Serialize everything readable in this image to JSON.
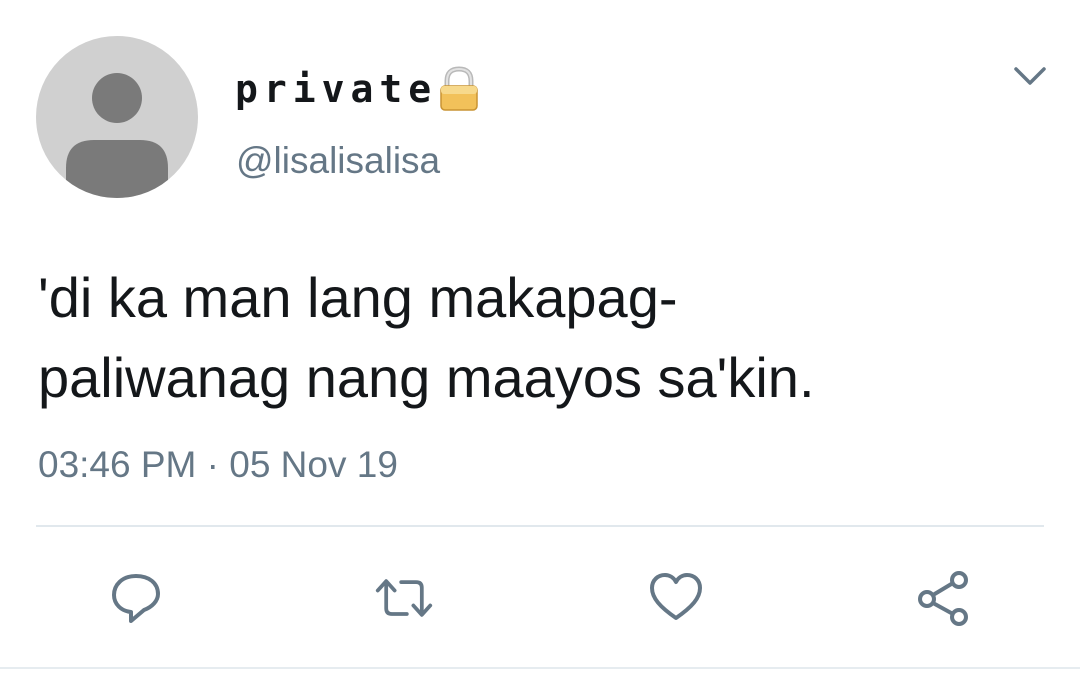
{
  "tweet": {
    "display_name": "private",
    "handle": "@lisalisalisa",
    "text": "'di ka man lang makapag-\npaliwanag nang maayos sa'kin.",
    "timestamp": "03:46 PM · 05 Nov 19"
  },
  "icons": {
    "lock": "lock-icon",
    "caret": "chevron-down-icon",
    "reply": "reply-icon",
    "retweet": "retweet-icon",
    "like": "heart-icon",
    "share": "share-icon"
  },
  "colors": {
    "text": "#14171a",
    "secondary": "#657786",
    "icon": "#657786",
    "divider": "#e1e8ed",
    "avatar_bg": "#d0d0d0",
    "avatar_fg": "#7a7a7a"
  }
}
